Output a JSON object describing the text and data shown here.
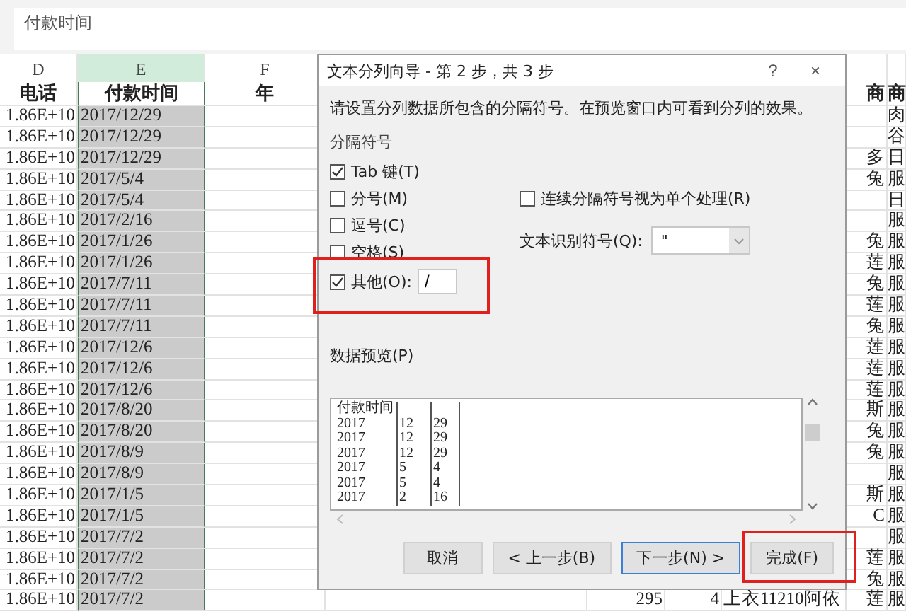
{
  "formula_bar": {
    "value": "付款时间"
  },
  "sheet": {
    "columns": [
      {
        "letter": "D",
        "label": "电话",
        "selected": false
      },
      {
        "letter": "E",
        "label": "付款时间",
        "selected": true
      },
      {
        "letter": "F",
        "label": "年",
        "selected": false
      },
      {
        "label": "商",
        "selected": false
      },
      {
        "label": "商",
        "selected": false
      }
    ],
    "rows": [
      {
        "phone": "1.86E+10",
        "payment_time": "2017/12/29",
        "category": "肉"
      },
      {
        "phone": "1.86E+10",
        "payment_time": "2017/12/29",
        "category": "谷"
      },
      {
        "phone": "1.86E+10",
        "payment_time": "2017/12/29",
        "supplier": "多",
        "category": "日"
      },
      {
        "phone": "1.86E+10",
        "payment_time": "2017/5/4",
        "supplier": "兔",
        "category": "服"
      },
      {
        "phone": "1.86E+10",
        "payment_time": "2017/5/4",
        "category": "日"
      },
      {
        "phone": "1.86E+10",
        "payment_time": "2017/2/16",
        "category": "服"
      },
      {
        "phone": "1.86E+10",
        "payment_time": "2017/1/26",
        "supplier": "兔",
        "category": "服"
      },
      {
        "phone": "1.86E+10",
        "payment_time": "2017/1/26",
        "supplier": "莲",
        "category": "服"
      },
      {
        "phone": "1.86E+10",
        "payment_time": "2017/7/11",
        "supplier": "兔",
        "category": "服"
      },
      {
        "phone": "1.86E+10",
        "payment_time": "2017/7/11",
        "supplier": "莲",
        "category": "服"
      },
      {
        "phone": "1.86E+10",
        "payment_time": "2017/7/11",
        "supplier": "兔",
        "category": "服"
      },
      {
        "phone": "1.86E+10",
        "payment_time": "2017/12/6",
        "supplier": "莲",
        "category": "服"
      },
      {
        "phone": "1.86E+10",
        "payment_time": "2017/12/6",
        "supplier": "莲",
        "category": "服"
      },
      {
        "phone": "1.86E+10",
        "payment_time": "2017/12/6",
        "supplier": "莲",
        "category": "服"
      },
      {
        "phone": "1.86E+10",
        "payment_time": "2017/8/20",
        "supplier": "斯",
        "category": "服"
      },
      {
        "phone": "1.86E+10",
        "payment_time": "2017/8/20",
        "supplier": "兔",
        "category": "服"
      },
      {
        "phone": "1.86E+10",
        "payment_time": "2017/8/9",
        "supplier": "兔",
        "category": "服"
      },
      {
        "phone": "1.86E+10",
        "payment_time": "2017/8/9",
        "category": "服"
      },
      {
        "phone": "1.86E+10",
        "payment_time": "2017/1/5",
        "supplier": "斯",
        "category": "服"
      },
      {
        "phone": "1.86E+10",
        "payment_time": "2017/1/5",
        "supplier": "C",
        "category": "服"
      },
      {
        "phone": "1.86E+10",
        "payment_time": "2017/7/2",
        "category": "服"
      },
      {
        "phone": "1.86E+10",
        "payment_time": "2017/7/2",
        "supplier": "莲",
        "category": "服"
      },
      {
        "phone": "1.86E+10",
        "payment_time": "2017/7/2",
        "supplier": "兔",
        "category": "服"
      },
      {
        "phone": "1.86E+10",
        "payment_time": "2017/7/2",
        "column_h": "295",
        "column_i": "4",
        "column_j": "上衣11210阿依",
        "supplier": "莲",
        "category": "服"
      }
    ]
  },
  "dialog": {
    "title": "文本分列向导 - 第 2 步，共 3 步",
    "help": "?",
    "close": "×",
    "description": "请设置分列数据所包含的分隔符号。在预览窗口内可看到分列的效果。",
    "delimiters_label": "分隔符号",
    "delimiters": [
      {
        "label": "Tab 键(T)",
        "checked": true
      },
      {
        "label": "分号(M)",
        "checked": false
      },
      {
        "label": "逗号(C)",
        "checked": false
      },
      {
        "label": "空格(S)",
        "checked": false
      },
      {
        "label": "其他(O):",
        "checked": true,
        "highlighted": true,
        "value": "/"
      }
    ],
    "consecutive": {
      "label": "连续分隔符号视为单个处理(R)",
      "checked": false
    },
    "qualifier": {
      "label": "文本识别符号(Q):",
      "value": "\""
    },
    "preview_label": "数据预览(P)",
    "preview_rows": [
      [
        "付款时间"
      ],
      [
        "2017",
        "12",
        "29"
      ],
      [
        "2017",
        "12",
        "29"
      ],
      [
        "2017",
        "12",
        "29"
      ],
      [
        "2017",
        "5",
        "4"
      ],
      [
        "2017",
        "5",
        "4"
      ],
      [
        "2017",
        "2",
        "16"
      ]
    ],
    "buttons": [
      {
        "label": "取消",
        "default": false
      },
      {
        "label": "< 上一步(B)",
        "default": false
      },
      {
        "label": "下一步(N) >",
        "default": true
      },
      {
        "label": "完成(F)",
        "default": false,
        "highlighted": true
      }
    ]
  }
}
